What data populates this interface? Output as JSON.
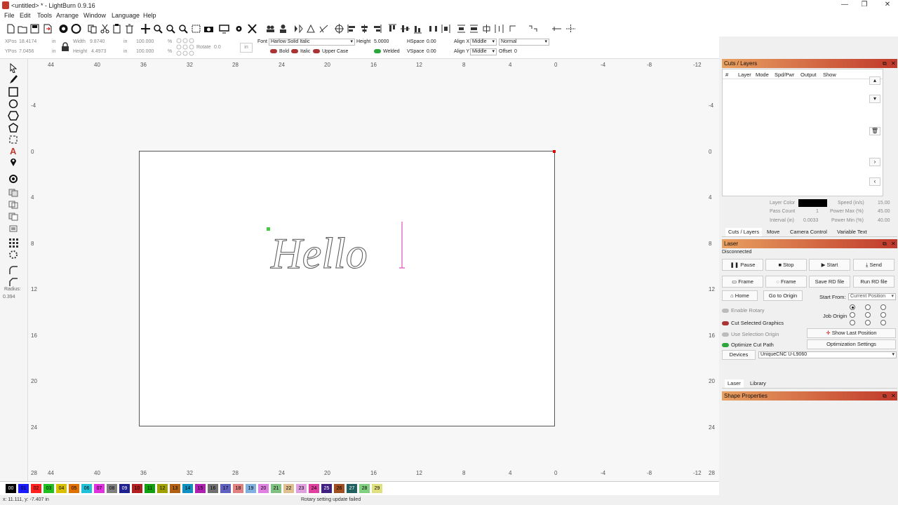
{
  "window": {
    "title": "<untitled> * - LightBurn 0.9.16",
    "minimize": "—",
    "maximize": "❐",
    "close": "✕"
  },
  "menu": [
    "File",
    "Edit",
    "Tools",
    "Arrange",
    "Window",
    "Language",
    "Help"
  ],
  "props": {
    "xpos_label": "XPos",
    "xpos": "18.4174",
    "ypos_label": "YPos",
    "ypos": "7.0456",
    "unit": "in",
    "width_label": "Width",
    "width": "9.8740",
    "height_label": "Height",
    "height": "4.4973",
    "wpct": "100.000",
    "hpct": "100.000",
    "pct": "%",
    "rotate_label": "Rotate",
    "rotate": "0.0",
    "rot_unit": "in",
    "font_label": "Font",
    "font": "Harlow Solid Italic",
    "fheight_label": "Height",
    "fheight": "5.0000",
    "hspace_label": "HSpace",
    "hspace": "0.00",
    "vspace_label": "VSpace",
    "vspace": "0.00",
    "alignx_label": "Align X",
    "alignx": "Middle",
    "aligny_label": "Align Y",
    "aligny": "Middle",
    "mode": "Normal",
    "offset_label": "Offset",
    "offset": "0",
    "bold": "Bold",
    "italic": "Italic",
    "upper": "Upper Case",
    "welded": "Welded"
  },
  "ruler": {
    "top": [
      "44",
      "40",
      "36",
      "32",
      "28",
      "24",
      "20",
      "16",
      "12",
      "8",
      "4",
      "0",
      "-4",
      "-8",
      "-12"
    ],
    "left": [
      "-4",
      "0",
      "4",
      "8",
      "12",
      "16",
      "20",
      "24",
      "28"
    ],
    "right": [
      "-4",
      "0",
      "4",
      "8",
      "12",
      "16",
      "20",
      "24",
      "28"
    ]
  },
  "tools": {
    "radius_label": "Radius:",
    "radius": "0.394"
  },
  "palette": [
    "00",
    "01",
    "02",
    "03",
    "04",
    "05",
    "06",
    "07",
    "08",
    "09",
    "10",
    "11",
    "12",
    "13",
    "14",
    "15",
    "16",
    "17",
    "18",
    "19",
    "20",
    "21",
    "22",
    "23",
    "24",
    "25",
    "26",
    "27",
    "28",
    "29"
  ],
  "palette_colors": [
    "#000000",
    "#1a1aff",
    "#ff2020",
    "#20c020",
    "#d8c000",
    "#e07000",
    "#20c0d8",
    "#e030e0",
    "#808080",
    "#202090",
    "#b02020",
    "#10a010",
    "#a0a000",
    "#b06010",
    "#1090c0",
    "#b020b0",
    "#707070",
    "#6060c0",
    "#e08080",
    "#80b0e0",
    "#e080e0",
    "#80c080",
    "#e0c090",
    "#e0a0e0",
    "#e040a0",
    "#402080",
    "#a05020",
    "#206060",
    "#80d080",
    "#e0e080"
  ],
  "status": {
    "coords": "x: 11.111, y: -7.407 in",
    "message": "Rotary setting update failed"
  },
  "cuts": {
    "title": "Cuts / Layers",
    "cols": [
      "#",
      "Layer",
      "Mode",
      "Spd/Pwr",
      "Output",
      "Show"
    ],
    "layer_color": "Layer Color",
    "speed_label": "Speed (in/s)",
    "speed": "15.00",
    "pass_label": "Pass Count",
    "pass": "1",
    "pmax_label": "Power Max (%)",
    "pmax": "45.00",
    "interval_label": "Interval (in)",
    "interval": "0.0033",
    "pmin_label": "Power Min (%)",
    "pmin": "40.00",
    "tabs": [
      "Cuts / Layers",
      "Move",
      "Camera Control",
      "Variable Text"
    ]
  },
  "laser": {
    "title": "Laser",
    "state": "Disconnected",
    "pause": "Pause",
    "stop": "Stop",
    "start": "Start",
    "send": "Send",
    "frame1": "Frame",
    "frame2": "Frame",
    "save_rd": "Save RD file",
    "run_rd": "Run RD file",
    "home": "Home",
    "goto": "Go to Origin",
    "start_from_label": "Start From:",
    "start_from": "Current Position",
    "job_origin": "Job Origin",
    "enable_rotary": "Enable Rotary",
    "cut_selected": "Cut Selected Graphics",
    "use_sel_origin": "Use Selection Origin",
    "opt_cut": "Optimize Cut Path",
    "show_last": "Show Last Position",
    "opt_settings": "Optimization Settings",
    "devices": "Devices",
    "device": "UniqueCNC U-L9060",
    "tabs": [
      "Laser",
      "Library"
    ]
  },
  "shape": {
    "title": "Shape Properties"
  },
  "text_content": "Hello"
}
